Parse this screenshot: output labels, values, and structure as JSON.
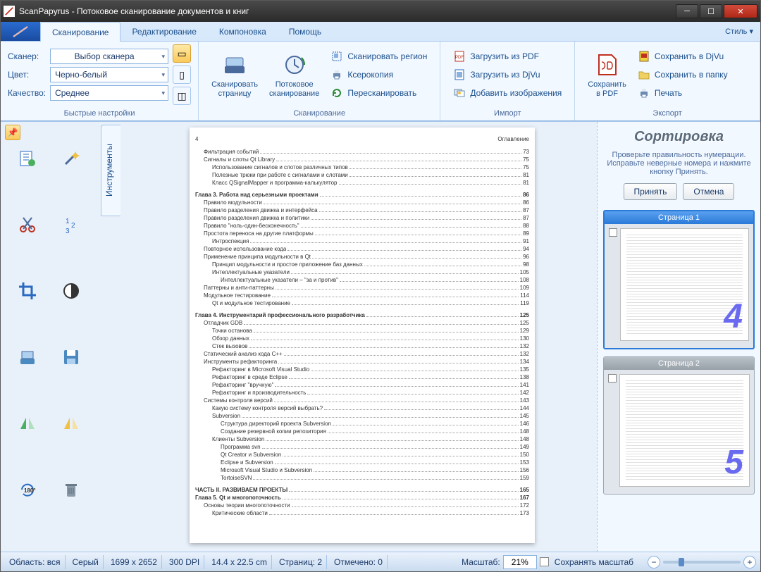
{
  "title": "ScanPapyrus - Потоковое сканирование документов и книг",
  "ribbon": {
    "tabs": [
      "Сканирование",
      "Редактирование",
      "Компоновка",
      "Помощь"
    ],
    "style": "Стиль",
    "quick": {
      "scanner_label": "Сканер:",
      "scanner_value": "Выбор сканера",
      "color_label": "Цвет:",
      "color_value": "Черно-белый",
      "quality_label": "Качество:",
      "quality_value": "Среднее",
      "group": "Быстрые настройки"
    },
    "scan": {
      "scan_page": "Сканировать\nстраницу",
      "stream_scan": "Потоковое\nсканирование",
      "scan_region": "Сканировать регион",
      "xerox": "Ксерокопия",
      "rescan": "Пересканировать",
      "group": "Сканирование"
    },
    "import": {
      "load_pdf": "Загрузить из PDF",
      "load_djvu": "Загрузить из DjVu",
      "add_images": "Добавить изображения",
      "group": "Импорт"
    },
    "export": {
      "save_pdf": "Сохранить\nв PDF",
      "save_djvu": "Сохранить в DjVu",
      "save_folder": "Сохранить в папку",
      "print": "Печать",
      "group": "Экспорт"
    }
  },
  "sidebar_tab": "Инструменты",
  "right": {
    "title": "Сортировка",
    "desc": "Проверьте правильность нумерации. Исправьте неверные номера и нажмите кнопку Принять.",
    "accept": "Принять",
    "cancel": "Отмена",
    "thumbs": [
      {
        "title": "Страница 1",
        "num": "4"
      },
      {
        "title": "Страница 2",
        "num": "5"
      }
    ]
  },
  "status": {
    "region": "Область: вся",
    "mode": "Серый",
    "size": "1699 x 2652",
    "dpi": "300 DPI",
    "cm": "14.4 x 22.5 cm",
    "pages": "Страниц: 2",
    "marked": "Отмечено: 0",
    "scale_label": "Масштаб:",
    "scale_value": "21%",
    "save_scale": "Сохранять масштаб"
  },
  "toc": {
    "page_no": "4",
    "header_right": "Оглавление",
    "rows": [
      {
        "t": "Фильтрация событий",
        "p": "73",
        "i": 1
      },
      {
        "t": "Сигналы и слоты Qt Library",
        "p": "75",
        "i": 1
      },
      {
        "t": "Использование сигналов и слотов различных типов",
        "p": "75",
        "i": 2
      },
      {
        "t": "Полезные трюки при работе с сигналами и слотами",
        "p": "81",
        "i": 2
      },
      {
        "t": "Класс QSignalMapper и программа-калькулятор",
        "p": "81",
        "i": 2
      },
      {
        "t": "Глава 3. Работа над серьезными проектами",
        "p": "86",
        "i": 0,
        "b": 1
      },
      {
        "t": "Правило модульности",
        "p": "86",
        "i": 1
      },
      {
        "t": "Правило разделения движка и интерфейса",
        "p": "87",
        "i": 1
      },
      {
        "t": "Правило разделения движка и политики",
        "p": "87",
        "i": 1
      },
      {
        "t": "Правило \"ноль-один-бесконечность\"",
        "p": "88",
        "i": 1
      },
      {
        "t": "Простота переноса на другие платформы",
        "p": "89",
        "i": 1
      },
      {
        "t": "Интроспекция",
        "p": "91",
        "i": 2
      },
      {
        "t": "Повторное использование кода",
        "p": "94",
        "i": 1
      },
      {
        "t": "Применение принципа модульности в Qt",
        "p": "96",
        "i": 1
      },
      {
        "t": "Принцип модульности и простое приложение баз данных",
        "p": "98",
        "i": 2
      },
      {
        "t": "Интеллектуальные указатели",
        "p": "105",
        "i": 2
      },
      {
        "t": "Интеллектуальные указатели – \"за и против\"",
        "p": "108",
        "i": 3
      },
      {
        "t": "Паттерны и анти-паттерны",
        "p": "109",
        "i": 1
      },
      {
        "t": "Модульное тестирование",
        "p": "114",
        "i": 1
      },
      {
        "t": "Qt и модульное тестирование",
        "p": "119",
        "i": 2
      },
      {
        "t": "Глава 4. Инструментарий профессионального разработчика",
        "p": "125",
        "i": 0,
        "b": 1
      },
      {
        "t": "Отладчик GDB",
        "p": "125",
        "i": 1
      },
      {
        "t": "Точки останова",
        "p": "129",
        "i": 2
      },
      {
        "t": "Обзор данных",
        "p": "130",
        "i": 2
      },
      {
        "t": "Стек вызовов",
        "p": "132",
        "i": 2
      },
      {
        "t": "Статический анализ кода C++",
        "p": "132",
        "i": 1
      },
      {
        "t": "Инструменты рефакторинга",
        "p": "134",
        "i": 1
      },
      {
        "t": "Рефакторинг в Microsoft Visual Studio",
        "p": "135",
        "i": 2
      },
      {
        "t": "Рефакторинг в среде Eclipse",
        "p": "138",
        "i": 2
      },
      {
        "t": "Рефакторинг \"вручную\"",
        "p": "141",
        "i": 2
      },
      {
        "t": "Рефакторинг и производительность",
        "p": "142",
        "i": 2
      },
      {
        "t": "Системы контроля версий",
        "p": "143",
        "i": 1
      },
      {
        "t": "Какую систему контроля версий выбрать?",
        "p": "144",
        "i": 2
      },
      {
        "t": "Subversion",
        "p": "145",
        "i": 2
      },
      {
        "t": "Структура директорий проекта Subversion",
        "p": "146",
        "i": 3
      },
      {
        "t": "Создание резервной копии репозитория",
        "p": "148",
        "i": 3
      },
      {
        "t": "Клиенты Subversion",
        "p": "148",
        "i": 2
      },
      {
        "t": "Программа svn",
        "p": "149",
        "i": 3
      },
      {
        "t": "Qt Creator и Subversion",
        "p": "150",
        "i": 3
      },
      {
        "t": "Eclipse и Subversion",
        "p": "153",
        "i": 3
      },
      {
        "t": "Microsoft Visual Studio и Subversion",
        "p": "156",
        "i": 3
      },
      {
        "t": "TortoiseSVN",
        "p": "159",
        "i": 3
      },
      {
        "t": "ЧАСТЬ II. РАЗВИВАЕМ ПРОЕКТЫ",
        "p": "165",
        "i": 0,
        "b": 1
      },
      {
        "t": "Глава 5. Qt и многопоточность",
        "p": "167",
        "i": 0,
        "b": 1
      },
      {
        "t": "Основы теории многопоточности",
        "p": "172",
        "i": 1
      },
      {
        "t": "Критические области",
        "p": "173",
        "i": 2
      }
    ]
  }
}
